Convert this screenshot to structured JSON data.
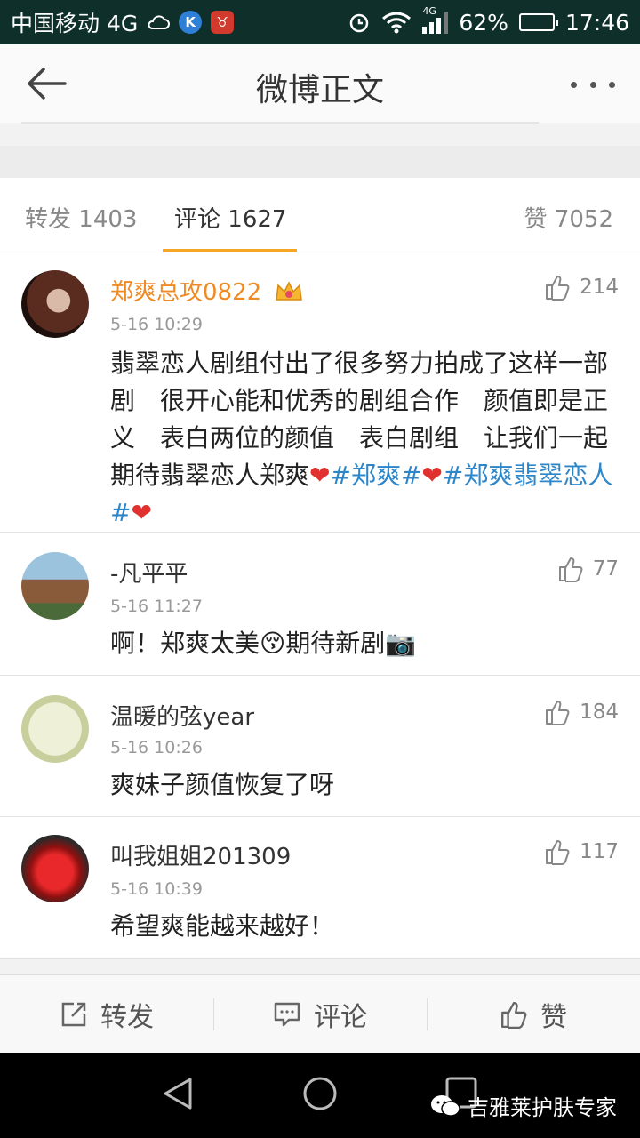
{
  "status_bar": {
    "carrier": "中国移动 4G",
    "net_small": "4G",
    "battery": "62%",
    "battery_level": 0.62,
    "time": "17:46",
    "app_k_label": "K"
  },
  "header": {
    "title": "微博正文"
  },
  "tabs": {
    "repost": {
      "label": "转发",
      "count": "1403"
    },
    "comments": {
      "label": "评论",
      "count": "1627"
    },
    "likes": {
      "label": "赞",
      "count": "7052"
    }
  },
  "comments": [
    {
      "username": "郑爽总攻0822",
      "time": "5-16 10:29",
      "likes": "214",
      "text": "翡翠恋人剧组付出了很多努力拍成了这样一部剧　很开心能和优秀的剧组合作　颜值即是正义　表白两位的颜值　表白剧组　让我们一起期待翡翠恋人郑爽",
      "hashtag1": "#郑爽#",
      "hashtag2": "#郑爽翡翠恋人#"
    },
    {
      "username": "-凡平平",
      "time": "5-16 11:27",
      "likes": "77",
      "text_a": "啊！郑爽太美",
      "text_b": "期待新剧"
    },
    {
      "username": "温暖的弦year",
      "time": "5-16 10:26",
      "likes": "184",
      "text": "爽妹子颜值恢复了呀"
    },
    {
      "username": "叫我姐姐201309",
      "time": "5-16 10:39",
      "likes": "117",
      "text": "希望爽能越来越好！"
    }
  ],
  "actions": {
    "repost": "转发",
    "comment": "评论",
    "like": "赞"
  },
  "watermark": "吉雅莱护肤专家",
  "colors": {
    "status_bar_bg": "#0e2f2a",
    "accent_orange": "#f5a623",
    "vip_name": "#f08a24",
    "hashtag": "#2d86c9",
    "heart": "#e0312e"
  },
  "icons": [
    "back-arrow-icon",
    "more-dots-icon",
    "crown-icon",
    "thumbs-up-icon",
    "share-icon",
    "comment-icon",
    "heart-emoji",
    "nav-back-icon",
    "nav-home-icon",
    "nav-recents-icon",
    "wechat-icon"
  ]
}
